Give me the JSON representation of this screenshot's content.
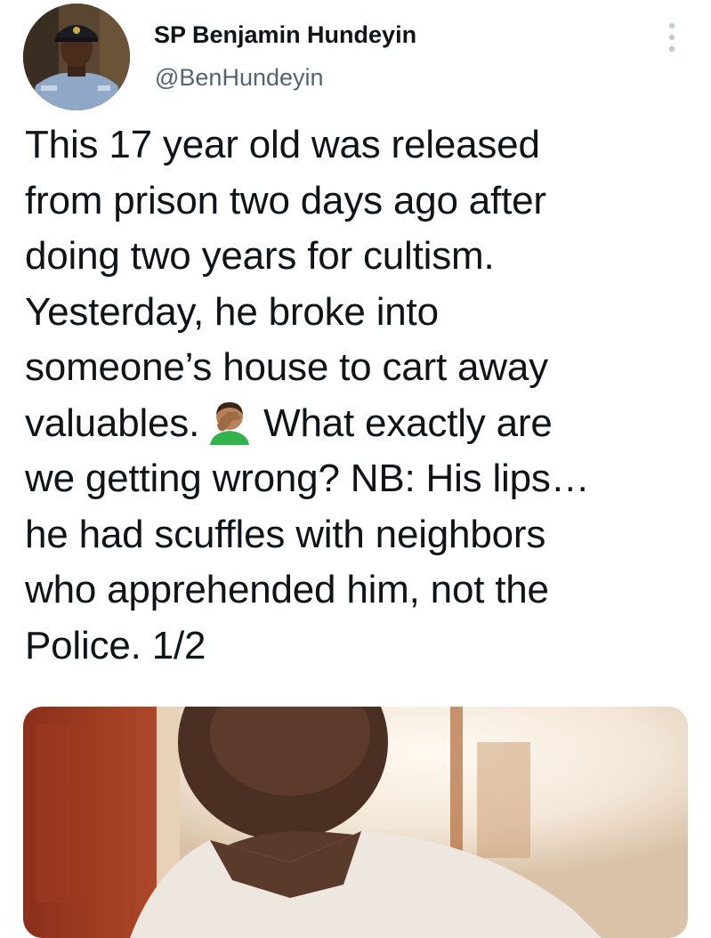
{
  "author": {
    "display_name": "SP Benjamin Hundeyin",
    "handle": "@BenHundeyin"
  },
  "tweet": {
    "line1": "This 17 year old was released",
    "line2": "from prison two days ago after",
    "line3": "doing two years for cultism.",
    "line4": "Yesterday, he broke into",
    "line5": "someone’s house to cart away",
    "line6a": "valuables.",
    "line6b": "What exactly are",
    "line7": "we getting wrong? NB: His lips…",
    "line8": "he had scuffles with neighbors",
    "line9": "who apprehended him, not the",
    "line10": "Police. 1/2"
  },
  "icons": {
    "more": "more-vertical-icon",
    "emoji": "man-facepalming-emoji"
  },
  "colors": {
    "text": "#0f1419",
    "secondary": "#536471",
    "background": "#ffffff"
  }
}
